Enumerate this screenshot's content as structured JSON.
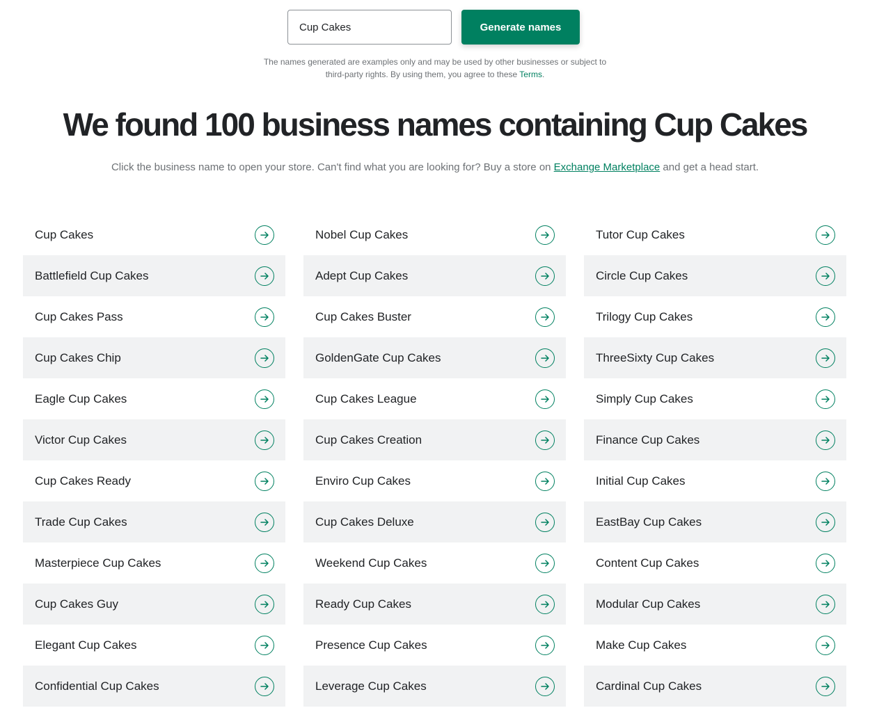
{
  "search": {
    "value": "Cup Cakes",
    "button_label": "Generate names"
  },
  "disclaimer": {
    "line1": "The names generated are examples only and may be used by other businesses or subject to",
    "line2": "third-party rights. By using them, you agree to these ",
    "terms_link": "Terms",
    "end": "."
  },
  "heading": "We found 100 business names containing Cup Cakes",
  "subtitle": {
    "before": "Click the business name to open your store. Can't find what you are looking for? Buy a store on ",
    "link": "Exchange Marketplace",
    "after": " and get a head start."
  },
  "accent_color": "#008060",
  "item_icon": "arrow-right-circle-icon",
  "columns": [
    [
      "Cup Cakes",
      "Battlefield Cup Cakes",
      "Cup Cakes Pass",
      "Cup Cakes Chip",
      "Eagle Cup Cakes",
      "Victor Cup Cakes",
      "Cup Cakes Ready",
      "Trade Cup Cakes",
      "Masterpiece Cup Cakes",
      "Cup Cakes Guy",
      "Elegant Cup Cakes",
      "Confidential Cup Cakes"
    ],
    [
      "Nobel Cup Cakes",
      "Adept Cup Cakes",
      "Cup Cakes Buster",
      "GoldenGate Cup Cakes",
      "Cup Cakes League",
      "Cup Cakes Creation",
      "Enviro Cup Cakes",
      "Cup Cakes Deluxe",
      "Weekend Cup Cakes",
      "Ready Cup Cakes",
      "Presence Cup Cakes",
      "Leverage Cup Cakes"
    ],
    [
      "Tutor Cup Cakes",
      "Circle Cup Cakes",
      "Trilogy Cup Cakes",
      "ThreeSixty Cup Cakes",
      "Simply Cup Cakes",
      "Finance Cup Cakes",
      "Initial Cup Cakes",
      "EastBay Cup Cakes",
      "Content Cup Cakes",
      "Modular Cup Cakes",
      "Make Cup Cakes",
      "Cardinal Cup Cakes"
    ]
  ]
}
